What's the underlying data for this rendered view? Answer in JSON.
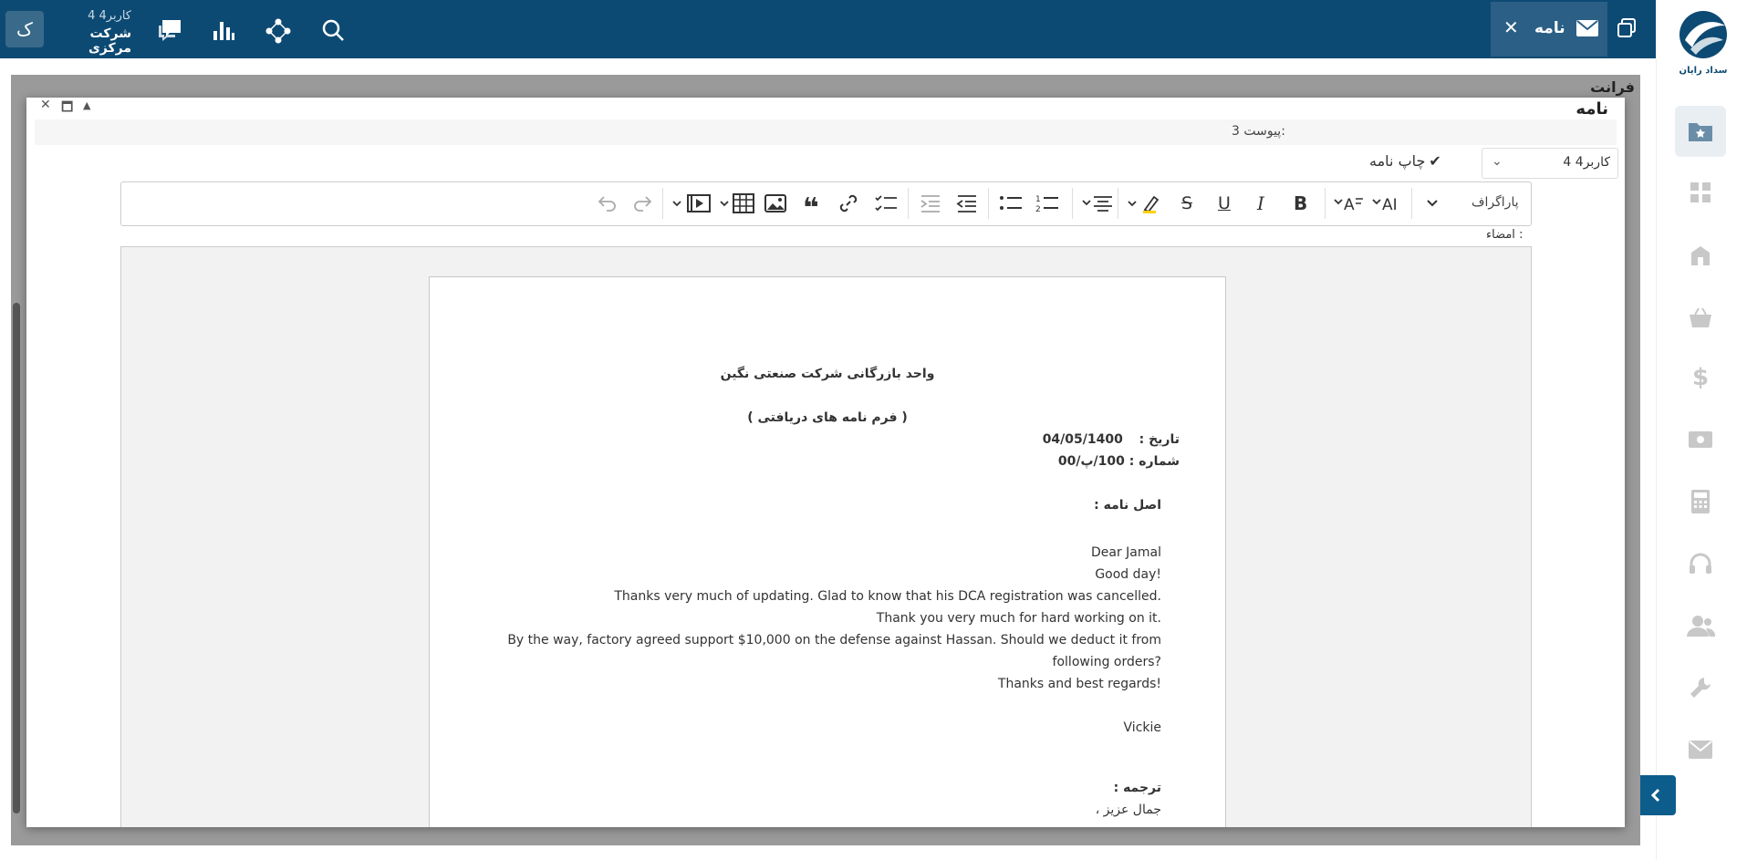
{
  "topbar": {
    "avatar_letter": "ک",
    "user_name": "کاربر4 4",
    "company": "شرکت مرکزی",
    "tab_label": "نامه",
    "colors": {
      "bar": "#0d4a73",
      "tab": "#2b5f85"
    },
    "icons": [
      "chat-icon",
      "chart-icon",
      "network-icon",
      "search-icon",
      "mail-icon",
      "close-icon",
      "windows-icon"
    ]
  },
  "sidebar": {
    "logo_text": "سداد رایان",
    "items": [
      "folder-star-icon",
      "dashboard-icon",
      "building-icon",
      "basket-icon",
      "dollar-icon",
      "cash-icon",
      "calculator-icon",
      "headset-icon",
      "users-icon",
      "wrench-icon",
      "mail-icon"
    ],
    "accent": "#0d5d8c"
  },
  "background": {
    "title": "فرانت"
  },
  "modal": {
    "title": "نامه",
    "attachments": "پیوست 3:",
    "print_label": "چاپ نامه",
    "print_check": "✔",
    "user_select": "کاربر4 4",
    "paragraph_label": "پاراگراف",
    "signature_label": "امضاء :"
  },
  "letter": {
    "header": "واحد بازرگانی شرکت صنعتی نگین",
    "subheader": "( فرم نامه های دریافتی )",
    "date_label": "تاریخ :",
    "date_value": "04/05/1400",
    "number_label": "شماره :",
    "number_value": "100/پ/00",
    "original_label": "اصل نامه :",
    "body_lines": [
      "Dear Jamal",
      "Good day!",
      "Thanks very much of updating. Glad to know that his DCA registration was cancelled.",
      "Thank you very much for hard working on it.",
      "By the way, factory agreed support $10,000 on the defense against Hassan. Should we deduct it from",
      "following orders?",
      "Thanks and best regards!",
      "",
      "Vickie"
    ],
    "translation_label": "ترجمه :",
    "translation_first": "جمال عزیز ،"
  }
}
